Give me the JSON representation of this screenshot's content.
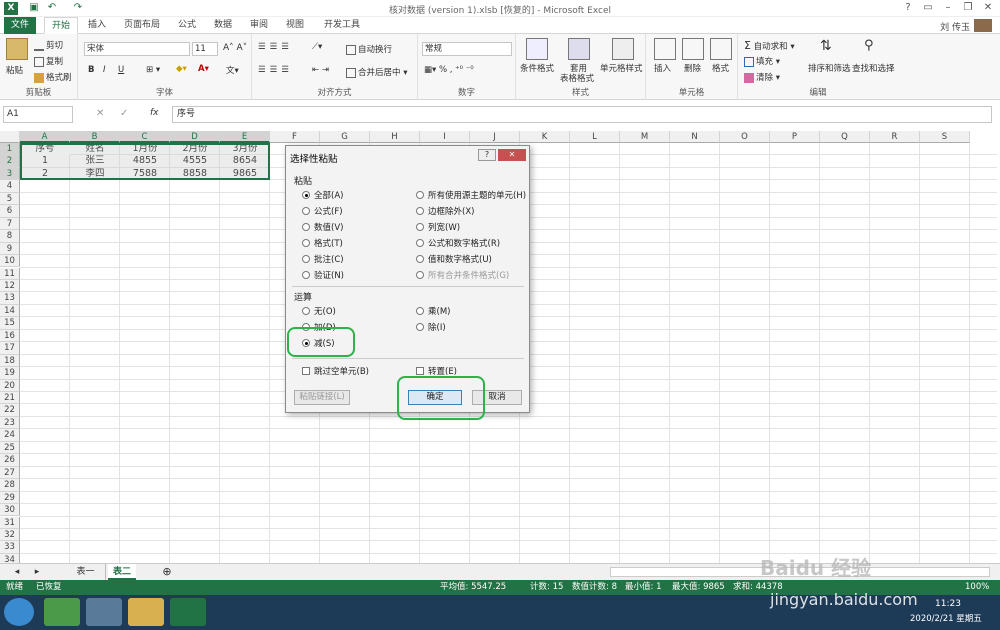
{
  "title": "核对数据 (version 1).xlsb [恢复的] - Microsoft Excel",
  "user": "刘 传玉",
  "tabs": [
    "文件",
    "开始",
    "插入",
    "页面布局",
    "公式",
    "数据",
    "审阅",
    "视图",
    "开发工具"
  ],
  "ribbon": {
    "clipboard": {
      "paste": "粘贴",
      "cut": "剪切",
      "copy": "复制",
      "painter": "格式刷",
      "label": "剪贴板"
    },
    "font": {
      "name": "宋体",
      "size": "11",
      "bold": "B",
      "italic": "I",
      "underline": "U",
      "label": "字体"
    },
    "align": {
      "wrap": "自动换行",
      "merge": "合并后居中",
      "label": "对齐方式"
    },
    "number": {
      "format": "常规",
      "label": "数字"
    },
    "styles": {
      "cond": "条件格式",
      "table1": "套用",
      "table2": "表格格式",
      "cell": "单元格样式",
      "label": "样式"
    },
    "cells": {
      "insert": "插入",
      "delete": "删除",
      "format": "格式",
      "label": "单元格"
    },
    "edit": {
      "sum": "自动求和",
      "fill": "填充",
      "clear": "清除",
      "sort": "排序和筛选",
      "find": "查找和选择",
      "label": "编辑"
    }
  },
  "namebox": "A1",
  "formula": "序号",
  "fx": "fx",
  "columns": [
    "A",
    "B",
    "C",
    "D",
    "E",
    "F",
    "G",
    "H",
    "I",
    "J",
    "K",
    "L",
    "M",
    "N",
    "O",
    "P",
    "Q",
    "R",
    "S"
  ],
  "rows": [
    "1",
    "2",
    "3",
    "4",
    "5",
    "6",
    "7",
    "8",
    "9",
    "10",
    "11",
    "12",
    "13",
    "14",
    "15",
    "16",
    "17",
    "18",
    "19",
    "20",
    "21",
    "22",
    "23",
    "24",
    "25",
    "26",
    "27",
    "28",
    "29",
    "30",
    "31",
    "32",
    "33",
    "34"
  ],
  "table": [
    [
      "序号",
      "姓名",
      "1月份",
      "2月份",
      "3月份"
    ],
    [
      "1",
      "张三",
      "4855",
      "4555",
      "8654"
    ],
    [
      "2",
      "李四",
      "7588",
      "8858",
      "9865"
    ]
  ],
  "sheets": [
    "表一",
    "表二"
  ],
  "status": {
    "ready": "就绪",
    "recovered": "已恢复",
    "avg": "平均值: 5547.25",
    "count": "计数: 15",
    "numcount": "数值计数: 8",
    "min": "最小值: 1",
    "max": "最大值: 9865",
    "sum": "求和: 44378",
    "zoom": "100%"
  },
  "dialog": {
    "title": "选择性粘贴",
    "help": "?",
    "close": "✕",
    "paste_label": "粘贴",
    "paste_left": [
      "全部(A)",
      "公式(F)",
      "数值(V)",
      "格式(T)",
      "批注(C)",
      "验证(N)"
    ],
    "paste_right": [
      "所有使用源主题的单元(H)",
      "边框除外(X)",
      "列宽(W)",
      "公式和数字格式(R)",
      "值和数字格式(U)",
      "所有合并条件格式(G)"
    ],
    "op_label": "运算",
    "op_left": [
      "无(O)",
      "加(D)",
      "减(S)"
    ],
    "op_right": [
      "乘(M)",
      "除(I)"
    ],
    "skip": "跳过空单元(B)",
    "transpose": "转置(E)",
    "link": "粘贴链接(L)",
    "ok": "确定",
    "cancel": "取消"
  },
  "taskbar": {
    "time": "11:23",
    "date": "2020/2/21 星期五"
  },
  "watermark": "Baidu 经验",
  "watermark_url": "jingyan.baidu.com"
}
